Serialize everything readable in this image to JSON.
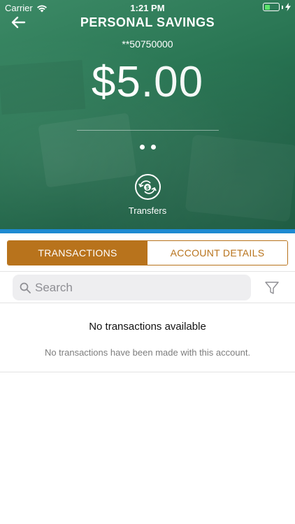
{
  "status_bar": {
    "carrier": "Carrier",
    "time": "1:21 PM",
    "battery_level": 0.4,
    "battery_color": "#5be36a"
  },
  "header": {
    "back_icon": "back-arrow-icon",
    "title": "PERSONAL SAVINGS",
    "account_number": "**50750000",
    "balance_main": "$5",
    "balance_cents": ".00",
    "page_indicator": {
      "count": 2
    }
  },
  "actions": {
    "transfers_icon": "money-transfer-icon",
    "transfers_label": "Transfers"
  },
  "tabs": {
    "active_label": "TRANSACTIONS",
    "inactive_label": "ACCOUNT DETAILS",
    "accent_color": "#b8731c"
  },
  "search": {
    "placeholder": "Search",
    "search_icon": "search-icon",
    "filter_icon": "filter-icon"
  },
  "empty_state": {
    "title": "No transactions available",
    "message": "No transactions have been made with this account."
  },
  "colors": {
    "header_green": "#2a7654",
    "band_blue": "#1e8ad1"
  }
}
